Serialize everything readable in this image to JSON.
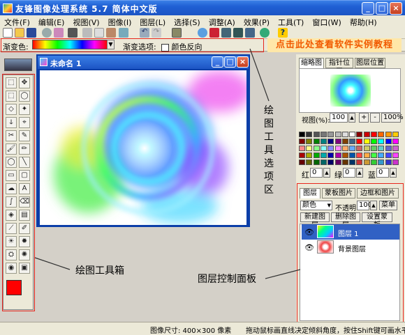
{
  "title": "友锋图像处理系统 5.7 简体中文版",
  "window_buttons": {
    "min": "_",
    "max": "□",
    "close": "×"
  },
  "menu": [
    "文件(F)",
    "编辑(E)",
    "视图(V)",
    "图像(I)",
    "图层(L)",
    "选择(S)",
    "调整(A)",
    "效果(P)",
    "工具(T)",
    "窗口(W)",
    "帮助(H)"
  ],
  "options": {
    "gradient_label": "渐变色:",
    "options_label": "渐变选项:",
    "reverse_label": "颜色反向"
  },
  "promo": "点击此处查看软件实例教程",
  "document": {
    "title": "未命名 1"
  },
  "navigator": {
    "tabs": [
      "缩略图",
      "指针位置",
      "图层位置"
    ],
    "zoom_label": "视图(%):",
    "zoom_value": "100",
    "zoom_plus": "+",
    "zoom_minus": "-",
    "zoom_fit": "100%"
  },
  "rgb": {
    "r_label": "红",
    "r_value": "0",
    "g_label": "绿",
    "g_value": "0",
    "b_label": "蓝",
    "b_value": "0"
  },
  "layers": {
    "tabs": [
      "图层",
      "蒙板图片",
      "边框和图片"
    ],
    "mode": "颜色",
    "opacity_label": "不透明",
    "opacity_value": "100",
    "menu_btn": "菜单",
    "new_btn": "新建图层",
    "delete_btn": "删除图层",
    "mask_btn": "设置蒙板",
    "items": [
      {
        "name": "图层 1",
        "selected": true
      },
      {
        "name": "背景图层",
        "selected": false
      }
    ]
  },
  "annotations": {
    "toolbox": "绘图工具箱",
    "options": "绘图工具选项区",
    "layers": "图层控制面板"
  },
  "status": {
    "size": "图像尺寸: 400×300 像素",
    "hint": "拖动鼠标画直线决定倾斜角度，按住Shift键可画水平"
  },
  "colors": {
    "accent": "#1c54c4",
    "highlight": "#e8261c",
    "promo": "#f15a00"
  }
}
